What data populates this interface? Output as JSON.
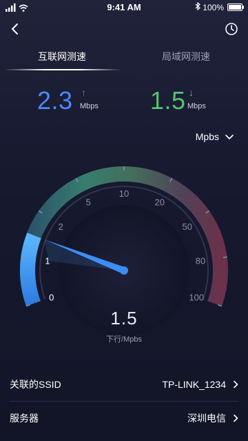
{
  "status_bar": {
    "time": "9:41 AM",
    "battery": "100%"
  },
  "tabs": [
    {
      "label": "互联网测速",
      "active": true
    },
    {
      "label": "局域网测速",
      "active": false
    }
  ],
  "upload": {
    "value": "2.3",
    "unit": "Mbps",
    "arrow": "↑",
    "color": "#4e87f5"
  },
  "download": {
    "value": "1.5",
    "unit": "Mbps",
    "arrow": "↓",
    "color": "#56c46c"
  },
  "unit_selector": {
    "selected": "Mpbs"
  },
  "gauge": {
    "ticks": [
      "0",
      "1",
      "2",
      "5",
      "10",
      "20",
      "50",
      "80",
      "100"
    ],
    "current_value": "1.5",
    "label": "下行/Mpbs"
  },
  "info": {
    "ssid": {
      "label": "关联的SSID",
      "value": "TP-LINK_1234"
    },
    "server": {
      "label": "服务器",
      "value": "深圳电信"
    }
  }
}
